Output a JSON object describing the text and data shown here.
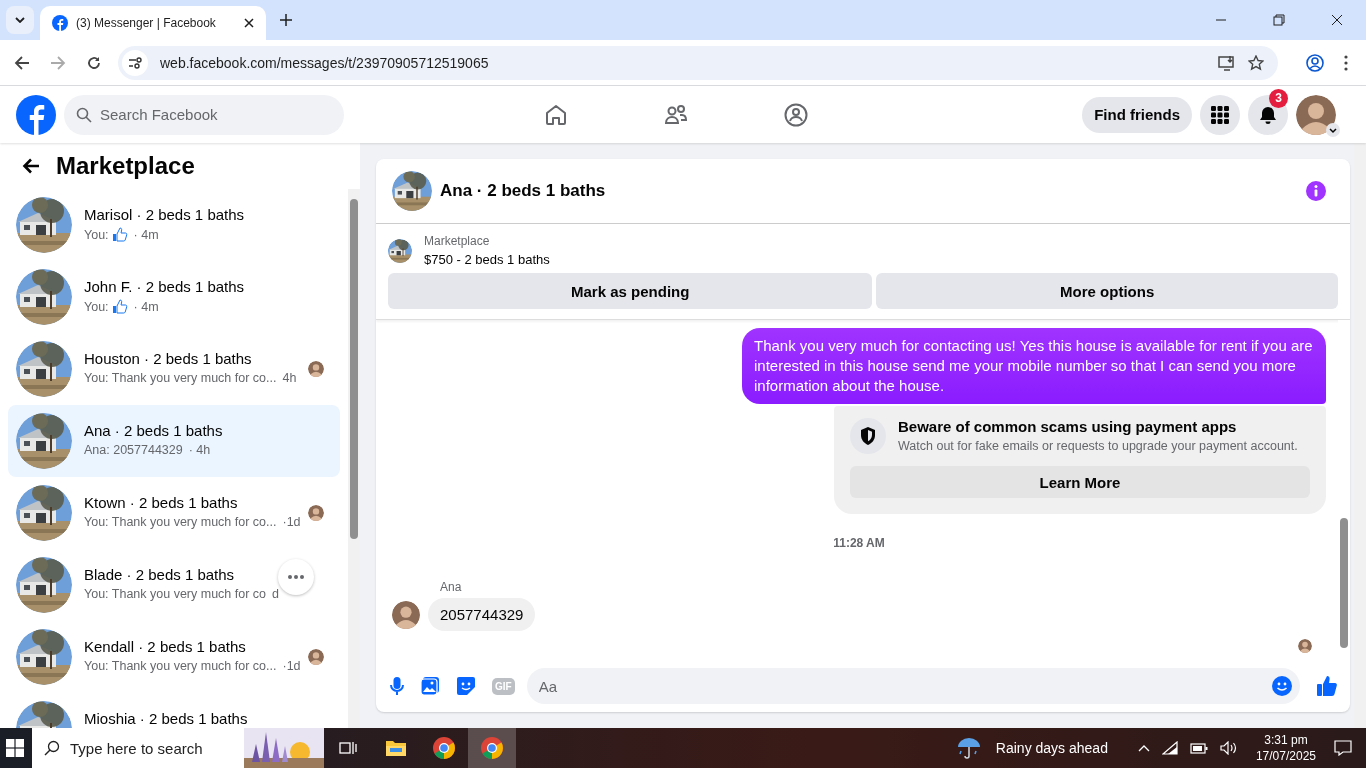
{
  "browser": {
    "tabs": [
      {
        "title": "(3) Messenger | Facebook",
        "selected": true
      }
    ],
    "url": "web.facebook.com/messages/t/23970905712519065"
  },
  "header": {
    "search": {
      "placeholder": "Search Facebook"
    },
    "find_friends": "Find friends",
    "notification_count": "3"
  },
  "sidebar": {
    "title": "Marketplace",
    "conversations": [
      {
        "title": "Marisol · 2 beds 1 baths",
        "kind": "like",
        "preview": "You:",
        "time": "· 4m",
        "selected": false,
        "seen": false
      },
      {
        "title": "John F. · 2 beds 1 baths",
        "kind": "like",
        "preview": "You:",
        "time": "· 4m",
        "selected": false,
        "seen": false
      },
      {
        "title": "Houston · 2 beds 1 baths",
        "kind": "text",
        "preview": "You: Thank you very much for co...",
        "time": "4h",
        "selected": false,
        "seen": true
      },
      {
        "title": "Ana · 2 beds 1 baths",
        "kind": "text",
        "preview": "Ana: 2057744329",
        "time": "· 4h",
        "selected": true,
        "seen": false
      },
      {
        "title": "Ktown · 2 beds 1 baths",
        "kind": "text",
        "preview": "You: Thank you very much for co...",
        "time": "·1d",
        "selected": false,
        "seen": true
      },
      {
        "title": "Blade · 2 beds 1 baths",
        "kind": "text",
        "preview": "You: Thank you very much for co",
        "time": "d",
        "selected": false,
        "seen": false,
        "more_button": true
      },
      {
        "title": "Kendall · 2 beds 1 baths",
        "kind": "text",
        "preview": "You: Thank you very much for co...",
        "time": "·1d",
        "selected": false,
        "seen": true
      },
      {
        "title": "Mioshia · 2 beds 1 baths",
        "selected": false,
        "seen": false
      }
    ]
  },
  "chat": {
    "title": "Ana · 2 beds 1 baths",
    "listing": {
      "source": "Marketplace",
      "summary": "$750 - 2 beds 1 baths"
    },
    "actions": [
      "Mark as pending",
      "More options"
    ],
    "messages": [
      {
        "kind": "outgoing",
        "text": "Thank you very much for contacting us! Yes this house is available for rent if you are interested in this house send me your mobile number so that I can send you more information about the house."
      },
      {
        "kind": "notice",
        "title": "Beware of common scams using payment apps",
        "body": "Watch out for fake emails or requests to upgrade your payment account.",
        "button": "Learn More"
      },
      {
        "kind": "timestamp",
        "text": "11:28 AM"
      },
      {
        "kind": "incoming",
        "sender": "Ana",
        "text": "2057744329"
      },
      {
        "kind": "seen"
      }
    ],
    "composer": {
      "placeholder": "Aa",
      "gif_label": "GIF"
    }
  },
  "taskbar": {
    "search": {
      "placeholder": "Type here to search"
    },
    "apps": [
      {
        "kind": "taskview",
        "selected": false
      },
      {
        "kind": "explorer",
        "selected": false
      },
      {
        "kind": "chrome",
        "selected": false
      },
      {
        "kind": "chrome",
        "selected": true
      }
    ],
    "weather": "Rainy days ahead",
    "time": "3:31 pm",
    "date": "17/07/2025"
  }
}
